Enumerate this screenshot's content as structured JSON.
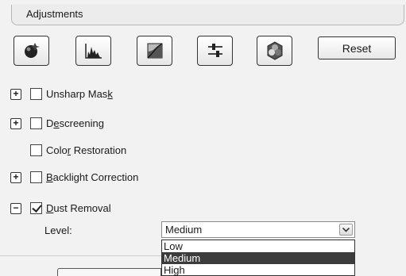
{
  "section": {
    "title": "Adjustments"
  },
  "toolbar": {
    "buttons": [
      {
        "icon": "auto-adjust-icon"
      },
      {
        "icon": "histogram-icon"
      },
      {
        "icon": "tone-curve-icon"
      },
      {
        "icon": "image-adjust-sliders-icon"
      },
      {
        "icon": "color-palette-icon"
      }
    ],
    "reset_label": "Reset"
  },
  "options": [
    {
      "pre": "Unsharp Mas",
      "key": "k",
      "post": "",
      "expander": "+",
      "checked": false
    },
    {
      "pre": "D",
      "key": "e",
      "post": "screening",
      "expander": "+",
      "checked": false
    },
    {
      "pre": "Colo",
      "key": "r",
      "post": " Restoration",
      "expander": null,
      "checked": false
    },
    {
      "pre": "",
      "key": "B",
      "post": "acklight Correction",
      "expander": "+",
      "checked": false
    },
    {
      "pre": "",
      "key": "D",
      "post": "ust Removal",
      "expander": "−",
      "checked": true
    }
  ],
  "level": {
    "label": "Level:",
    "selected": "Medium",
    "options": [
      "Low",
      "Medium",
      "High"
    ]
  }
}
